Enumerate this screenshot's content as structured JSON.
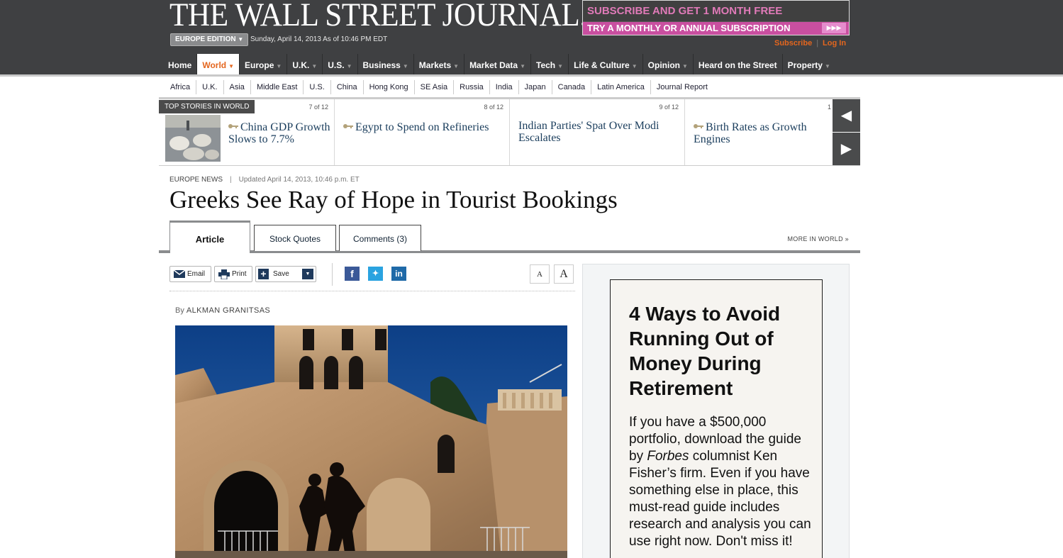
{
  "header": {
    "masthead": "THE WALL STREET JOURNAL.",
    "edition": "EUROPE EDITION",
    "dateline": "Sunday, April 14, 2013 As of 10:46 PM EDT",
    "promo_line1": "SUBSCRIBE AND GET 1 MONTH FREE",
    "promo_line2": "TRY A MONTHLY OR ANNUAL SUBSCRIPTION",
    "subscribe": "Subscribe",
    "login": "Log In"
  },
  "nav": {
    "items": [
      {
        "label": "Home"
      },
      {
        "label": "World"
      },
      {
        "label": "Europe"
      },
      {
        "label": "U.K."
      },
      {
        "label": "U.S."
      },
      {
        "label": "Business"
      },
      {
        "label": "Markets"
      },
      {
        "label": "Market Data"
      },
      {
        "label": "Tech"
      },
      {
        "label": "Life & Culture"
      },
      {
        "label": "Opinion"
      },
      {
        "label": "Heard on the Street"
      },
      {
        "label": "Property"
      }
    ],
    "active": "World"
  },
  "subnav": [
    "Africa",
    "U.K.",
    "Asia",
    "Middle East",
    "U.S.",
    "China",
    "Hong Kong",
    "SE Asia",
    "Russia",
    "India",
    "Japan",
    "Canada",
    "Latin America",
    "Journal Report"
  ],
  "top_stories": {
    "label": "TOP STORIES IN WORLD",
    "stories": [
      {
        "count": "7 of 12",
        "headline": "China GDP Growth Slows to 7.7%"
      },
      {
        "count": "8 of 12",
        "headline": "Egypt to Spend on Refineries"
      },
      {
        "count": "9 of 12",
        "headline": "Indian Parties' Spat Over Modi Escalates"
      },
      {
        "count": "1",
        "headline": "Birth Rates as Growth Engines"
      }
    ],
    "prev_icon": "chevron-left-icon",
    "next_icon": "chevron-right-icon"
  },
  "article": {
    "section": "EUROPE NEWS",
    "updated": "Updated April 14, 2013, 10:46 p.m. ET",
    "headline": "Greeks See Ray of Hope in Tourist Bookings",
    "byline_prefix": "By",
    "author": "ALKMAN GRANITSAS"
  },
  "tabs": [
    {
      "label": "Article"
    },
    {
      "label": "Stock Quotes"
    },
    {
      "label": "Comments (3)"
    }
  ],
  "more_in_world": "MORE IN WORLD »",
  "toolbar": {
    "email": "Email",
    "print": "Print",
    "save": "Save",
    "font_small": "A",
    "font_large": "A"
  },
  "ad": {
    "headline": "4 Ways to Avoid Running Out of Money During Retirement",
    "body_before": "If you have a $500,000 portfolio, download the guide by ",
    "body_em": "Forbes",
    "body_after": " columnist Ken Fisher’s firm. Even if you have something else in place, this must-read guide includes research and analysis you can use right now. Don't miss it!"
  },
  "colors": {
    "header_bg": "#3f4042",
    "accent": "#e4661e",
    "promo_pink": "#c94fa0",
    "facebook": "#3b5998",
    "twitter": "#2aa3e0",
    "linkedin": "#1f6aa8"
  }
}
